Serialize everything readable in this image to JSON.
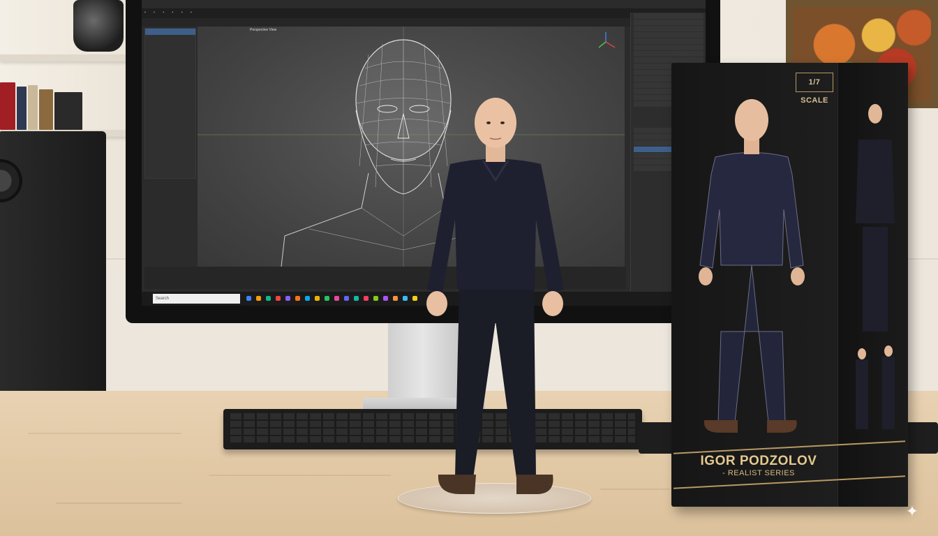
{
  "screen": {
    "viewport_label": "Perspective View",
    "task_search_placeholder": "Search"
  },
  "box": {
    "scale_label": "1/7 SCALE",
    "title": "IGOR PODZOLOV",
    "subtitle": "- REALIST SERIES"
  },
  "icons": {
    "sparkle": "sparkle-icon"
  },
  "colors": {
    "box_gold": "#b79a63",
    "box_dark": "#1a1a1a",
    "sweater": "#1d1f2e",
    "desk": "#e2c9a6"
  }
}
